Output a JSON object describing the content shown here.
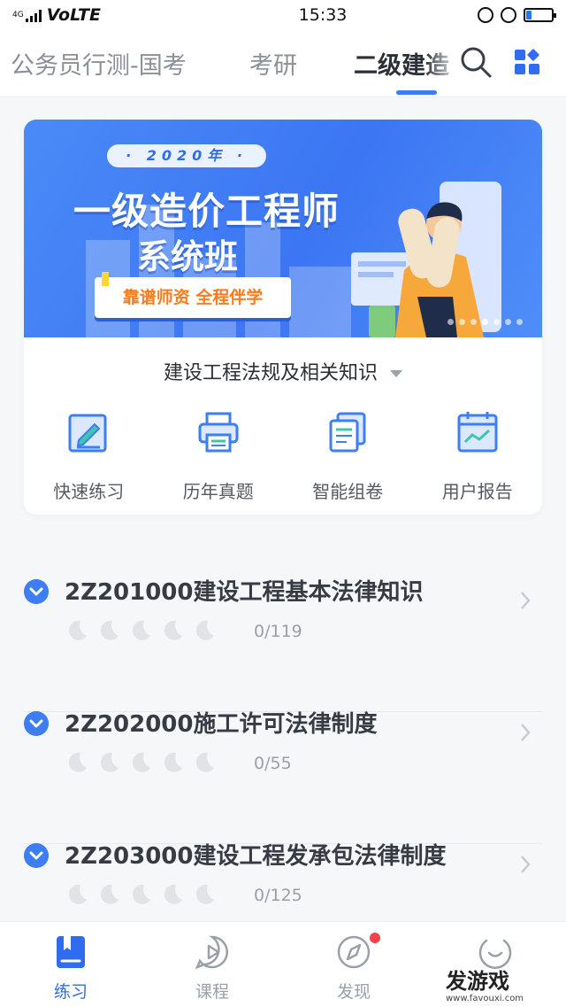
{
  "status_bar": {
    "network_type": "4G",
    "carrier_label": "VoLTE",
    "time": "15:33",
    "battery_level": 0.22
  },
  "top_nav": {
    "tabs": [
      {
        "label": "公务员行测-国考",
        "active": false
      },
      {
        "label": "考研",
        "active": false
      },
      {
        "label": "二级建造",
        "active": true
      }
    ],
    "search_icon": "search-icon",
    "grid_icon": "category-grid-icon"
  },
  "banner": {
    "year": "· 2020年 ·",
    "title_line1": "一级造价工程师",
    "title_line2": "系统班",
    "tagline": "靠谱师资 全程伴学",
    "slide_count": 7,
    "active_slide": 4
  },
  "subject_selector": {
    "label": "建设工程法规及相关知识"
  },
  "features": [
    {
      "label": "快速练习",
      "icon": "edit-note-icon"
    },
    {
      "label": "历年真题",
      "icon": "printer-icon"
    },
    {
      "label": "智能组卷",
      "icon": "document-stack-icon"
    },
    {
      "label": "用户报告",
      "icon": "chart-report-icon"
    }
  ],
  "chapters": [
    {
      "title": "2Z201000建设工程基本法律知识",
      "progress": "0/119",
      "stars_filled": 0,
      "stars_total": 5
    },
    {
      "title": "2Z202000施工许可法律制度",
      "progress": "0/55",
      "stars_filled": 0,
      "stars_total": 5
    },
    {
      "title": "2Z203000建设工程发承包法律制度",
      "progress": "0/125",
      "stars_filled": 0,
      "stars_total": 5
    }
  ],
  "bottom_nav": [
    {
      "label": "练习",
      "active": true,
      "icon": "practice-book-icon"
    },
    {
      "label": "课程",
      "active": false,
      "icon": "course-play-icon"
    },
    {
      "label": "发现",
      "active": false,
      "icon": "discover-compass-icon",
      "has_badge": true
    },
    {
      "label": "",
      "active": false,
      "icon": "profile-smile-icon"
    }
  ],
  "watermark": {
    "brand": "发游戏",
    "url": "www.favouxi.com"
  },
  "colors": {
    "accent": "#3f7cf4",
    "banner_bg": "#3c76f3",
    "tag_orange": "#ff7a1a",
    "badge_red": "#f0424d"
  }
}
